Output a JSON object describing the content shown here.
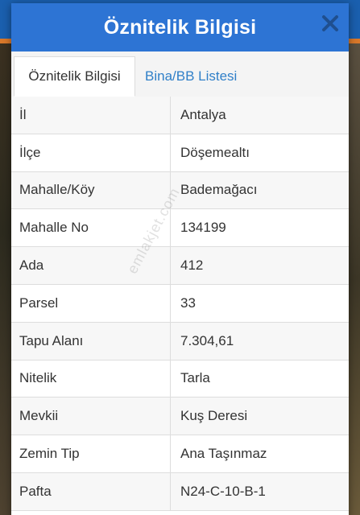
{
  "dialog": {
    "title": "Öznitelik Bilgisi"
  },
  "tabs": [
    {
      "label": "Öznitelik Bilgisi",
      "active": true
    },
    {
      "label": "Bina/BB Listesi",
      "active": false
    }
  ],
  "rows": [
    {
      "key": "İl",
      "value": "Antalya"
    },
    {
      "key": "İlçe",
      "value": "Döşemealtı"
    },
    {
      "key": "Mahalle/Köy",
      "value": "Bademağacı"
    },
    {
      "key": "Mahalle No",
      "value": "134199"
    },
    {
      "key": "Ada",
      "value": "412"
    },
    {
      "key": "Parsel",
      "value": "33"
    },
    {
      "key": "Tapu Alanı",
      "value": "7.304,61"
    },
    {
      "key": "Nitelik",
      "value": "Tarla"
    },
    {
      "key": "Mevkii",
      "value": "Kuş Deresi"
    },
    {
      "key": "Zemin Tip",
      "value": "Ana Taşınmaz"
    },
    {
      "key": "Pafta",
      "value": "N24-C-10-B-1"
    }
  ],
  "watermark": "emlakjet.com",
  "colors": {
    "header": "#2d74d4",
    "topbar": "#1a5fae",
    "accent": "#d9782a",
    "tab_link": "#2f7fc8"
  },
  "icons": {
    "menu": "vertical-dots-icon",
    "close": "close-icon"
  }
}
